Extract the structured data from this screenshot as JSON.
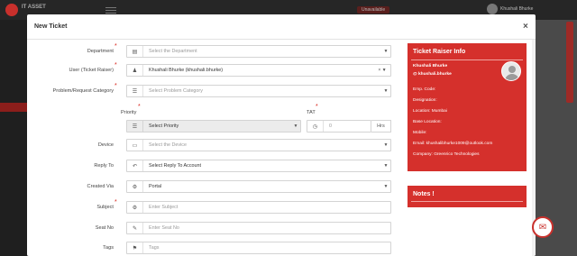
{
  "background": {
    "brand": "IT ASSET",
    "status_label": "Unavailable",
    "user_label": "Khushali Bhurke"
  },
  "modal": {
    "title": "New Ticket",
    "close": "×"
  },
  "form": {
    "department": {
      "label": "Department",
      "placeholder": "Select the Department"
    },
    "user": {
      "label": "User (Ticket Raiser)",
      "value": "Khushali Bhurke (khushali.bhurke)"
    },
    "category": {
      "label": "Problem/Request Category",
      "placeholder": "Select Problem Category"
    },
    "priority": {
      "label": "Priority",
      "value": "Select Priority"
    },
    "tat": {
      "label": "TAT",
      "value": "0",
      "unit": "Hrs"
    },
    "device": {
      "label": "Device",
      "placeholder": "Select the Device"
    },
    "reply_to": {
      "label": "Reply To",
      "value": "Select Reply To Account"
    },
    "created_via": {
      "label": "Created Via",
      "value": "Portal"
    },
    "subject": {
      "label": "Subject",
      "placeholder": "Enter Subject"
    },
    "seat_no": {
      "label": "Seat No",
      "placeholder": "Enter Seat No"
    },
    "tags": {
      "label": "Tags",
      "placeholder": "Tags"
    }
  },
  "raiser_info": {
    "title": "Ticket Raiser Info",
    "name": "Khushali Bhurke",
    "username": "@ khushali.bhurke",
    "emp_code": "Emp. Code:",
    "designation": "Designation:",
    "location": "Location: Mumbai",
    "base_location": "Base Location:",
    "mobile": "Mobile:",
    "email": "Email: khushalibhurke1009@outlook.com",
    "company": "Company: Greenrico Technologies"
  },
  "notes": {
    "title": "Notes !"
  },
  "colors": {
    "accent": "#d5302c",
    "required": "#d9261c"
  }
}
